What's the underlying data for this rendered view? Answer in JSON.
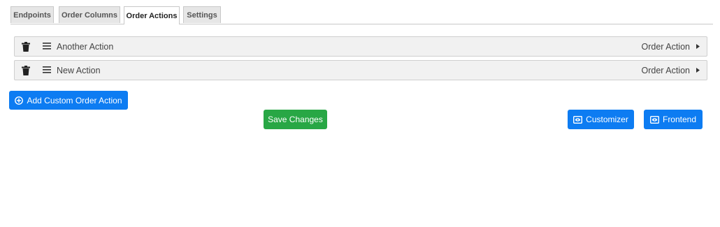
{
  "tabs": [
    {
      "label": "Endpoints",
      "active": false
    },
    {
      "label": "Order Columns",
      "active": false
    },
    {
      "label": "Order Actions",
      "active": true
    },
    {
      "label": "Settings",
      "active": false
    }
  ],
  "actions": [
    {
      "title": "Another Action",
      "type": "Order Action"
    },
    {
      "title": "New Action",
      "type": "Order Action"
    }
  ],
  "buttons": {
    "add_custom": "Add Custom Order Action",
    "save": "Save Changes",
    "customizer": "Customizer",
    "frontend": "Frontend"
  },
  "icons": {
    "trash": "trash-icon",
    "drag": "bars-icon",
    "caret": "caret-right-icon",
    "add": "plus-circle-icon",
    "preview": "eye-window-icon"
  },
  "colors": {
    "primary": "#0d7cf2",
    "success": "#28a745"
  }
}
